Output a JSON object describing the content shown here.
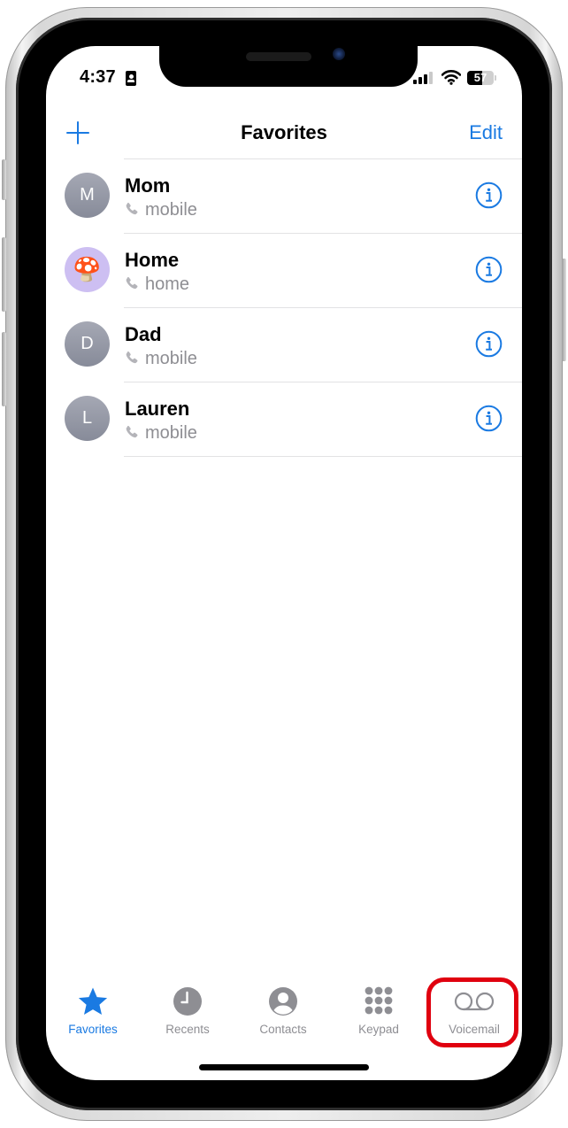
{
  "status_bar": {
    "time": "4:37",
    "focus_icon": "person-id-card-icon",
    "signal_bars_active": 3,
    "signal_bars_total": 4,
    "wifi_icon": "wifi-icon",
    "battery_percent": 57,
    "battery_label": "57"
  },
  "nav": {
    "add_icon": "plus-icon",
    "title": "Favorites",
    "edit_label": "Edit"
  },
  "favorites": [
    {
      "name": "Mom",
      "type": "mobile",
      "avatar": "M",
      "avatar_kind": "initial"
    },
    {
      "name": "Home",
      "type": "home",
      "avatar": "🍄",
      "avatar_kind": "emoji"
    },
    {
      "name": "Dad",
      "type": "mobile",
      "avatar": "D",
      "avatar_kind": "initial"
    },
    {
      "name": "Lauren",
      "type": "mobile",
      "avatar": "L",
      "avatar_kind": "initial"
    }
  ],
  "tabbar": {
    "tabs": [
      {
        "label": "Favorites",
        "icon": "star-icon",
        "active": true
      },
      {
        "label": "Recents",
        "icon": "clock-icon",
        "active": false
      },
      {
        "label": "Contacts",
        "icon": "person-circle-icon",
        "active": false
      },
      {
        "label": "Keypad",
        "icon": "keypad-icon",
        "active": false
      },
      {
        "label": "Voicemail",
        "icon": "voicemail-icon",
        "active": false
      }
    ],
    "highlighted_tab": "Voicemail"
  },
  "colors": {
    "accent": "#1a7ae2",
    "inactive": "#8e8e93",
    "highlight_ring": "#e0000f",
    "avatar_gray": "#8f939f",
    "avatar_emoji_bg": "#cdbff2"
  }
}
